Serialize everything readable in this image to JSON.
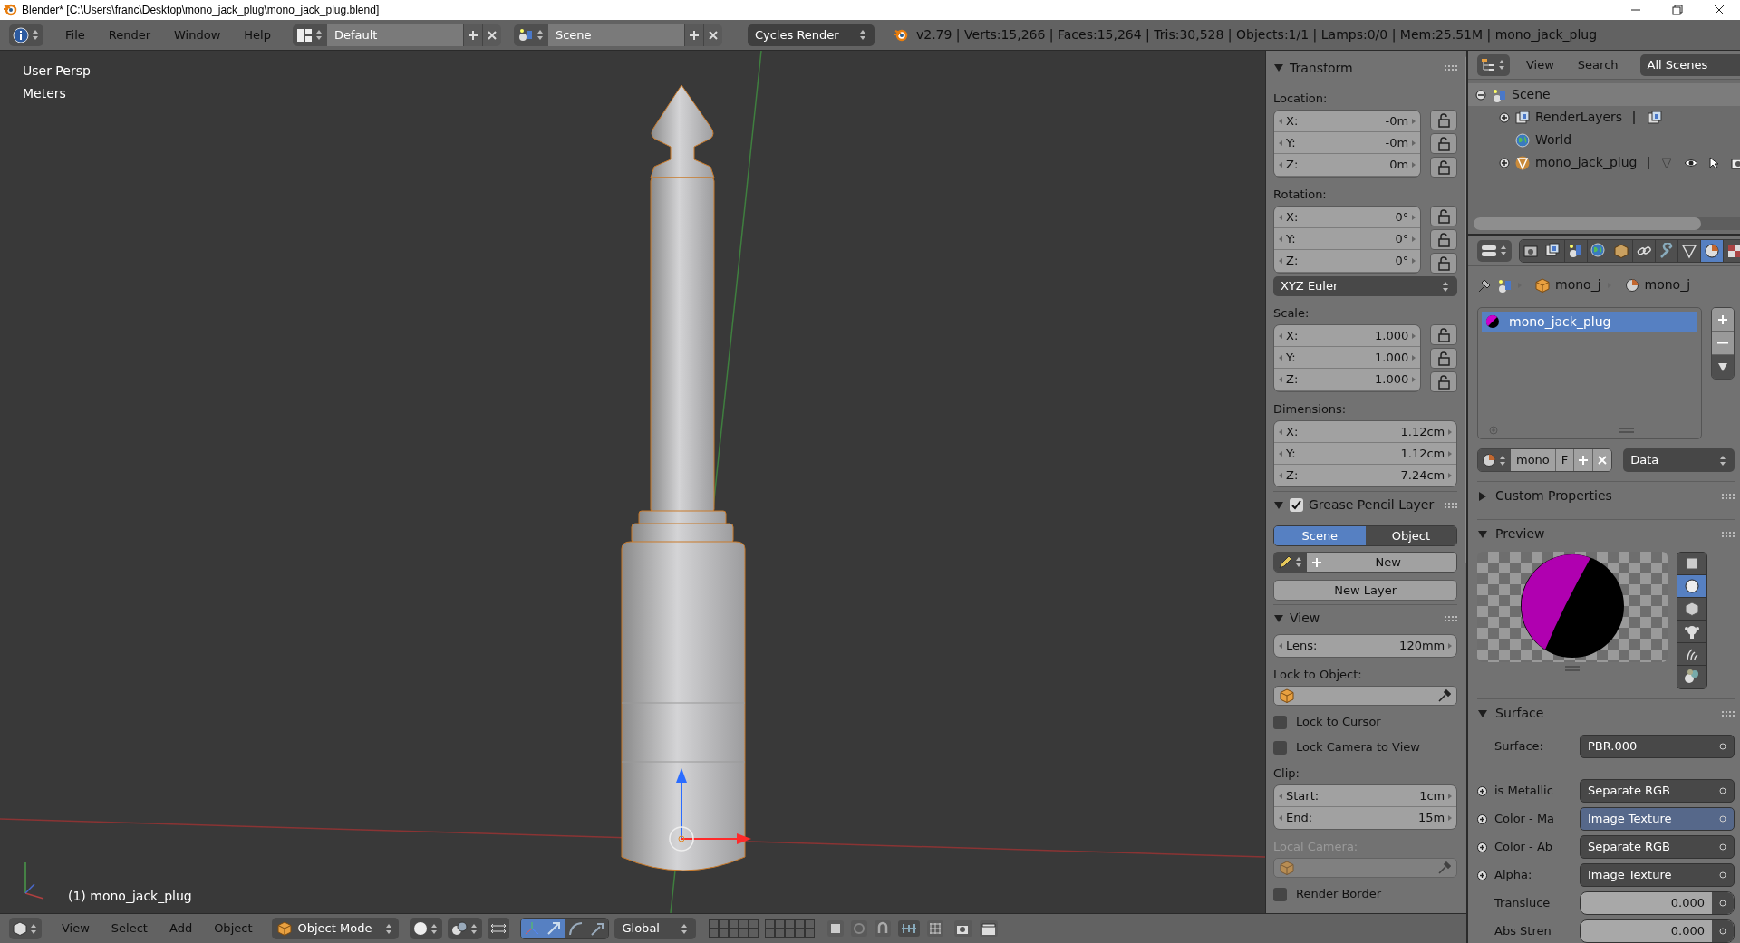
{
  "window": {
    "title": "Blender* [C:\\Users\\franc\\Desktop\\mono_jack_plug\\mono_jack_plug.blend]"
  },
  "info_header": {
    "menus": [
      "File",
      "Render",
      "Window",
      "Help"
    ],
    "screen_layout": "Default",
    "scene": "Scene",
    "render_engine": "Cycles Render",
    "stats": "v2.79 | Verts:15,266 | Faces:15,264 | Tris:30,528 | Objects:1/1 | Lamps:0/0 | Mem:25.51M | mono_jack_plug"
  },
  "viewport": {
    "view_name": "User Persp",
    "units": "Meters",
    "active_object": "(1) mono_jack_plug"
  },
  "n_panel": {
    "sections": [
      {
        "title": "Transform",
        "expanded": true,
        "rows": [
          {
            "kind": "label",
            "text": "Location:",
            "disabled": false
          },
          {
            "kind": "vector",
            "fields": [
              {
                "label": "X:",
                "value": "-0m",
                "locked": false
              },
              {
                "label": "Y:",
                "value": "-0m",
                "locked": false
              },
              {
                "label": "Z:",
                "value": "0m",
                "locked": false
              }
            ]
          },
          {
            "kind": "label",
            "text": "Rotation:",
            "disabled": false
          },
          {
            "kind": "vector",
            "fields": [
              {
                "label": "X:",
                "value": "0°",
                "locked": false
              },
              {
                "label": "Y:",
                "value": "0°",
                "locked": false
              },
              {
                "label": "Z:",
                "value": "0°",
                "locked": false
              }
            ]
          },
          {
            "kind": "dropdown",
            "value": "XYZ Euler"
          },
          {
            "kind": "label",
            "text": "Scale:",
            "disabled": false
          },
          {
            "kind": "vector",
            "fields": [
              {
                "label": "X:",
                "value": "1.000",
                "locked": false
              },
              {
                "label": "Y:",
                "value": "1.000",
                "locked": false
              },
              {
                "label": "Z:",
                "value": "1.000",
                "locked": false
              }
            ]
          },
          {
            "kind": "label",
            "text": "Dimensions:",
            "disabled": false
          },
          {
            "kind": "vector",
            "fields": [
              {
                "label": "X:",
                "value": "1.12cm"
              },
              {
                "label": "Y:",
                "value": "1.12cm"
              },
              {
                "label": "Z:",
                "value": "7.24cm"
              }
            ]
          }
        ]
      },
      {
        "title": "Grease Pencil Layer",
        "enabled": true,
        "expanded": true,
        "rows": [
          {
            "kind": "segmented",
            "options": [
              {
                "label": "Scene",
                "selected": true
              },
              {
                "label": "Object",
                "selected": false
              }
            ]
          },
          {
            "kind": "new_button",
            "label": "New"
          },
          {
            "kind": "button",
            "label": "New Layer"
          }
        ]
      },
      {
        "title": "View",
        "expanded": true,
        "rows": [
          {
            "kind": "vector",
            "fields": [
              {
                "label": "Lens:",
                "value": "120mm"
              }
            ]
          },
          {
            "kind": "label",
            "text": "Lock to Object:",
            "disabled": false
          },
          {
            "kind": "object_picker",
            "disabled": false
          },
          {
            "kind": "checkbox",
            "label": "Lock to Cursor",
            "checked": false
          },
          {
            "kind": "checkbox",
            "label": "Lock Camera to View",
            "checked": false
          },
          {
            "kind": "label",
            "text": "Clip:",
            "disabled": false
          },
          {
            "kind": "vector",
            "fields": [
              {
                "label": "Start:",
                "value": "1cm"
              },
              {
                "label": "End:",
                "value": "15m"
              }
            ]
          },
          {
            "kind": "label",
            "text": "Local Camera:",
            "disabled": true
          },
          {
            "kind": "object_picker",
            "disabled": true
          },
          {
            "kind": "checkbox",
            "label": "Render Border",
            "checked": false
          }
        ]
      }
    ]
  },
  "viewport_header": {
    "menus": [
      "View",
      "Select",
      "Add",
      "Object"
    ],
    "mode": "Object Mode",
    "orientation": "Global",
    "manipulators": [
      {
        "kind": "toggle",
        "selected": true
      },
      {
        "kind": "translate",
        "selected": true
      },
      {
        "kind": "rotate",
        "selected": false
      },
      {
        "kind": "scale",
        "selected": false
      }
    ]
  },
  "outliner": {
    "menus": [
      "View",
      "Search"
    ],
    "display_mode": "All Scenes",
    "tree": [
      {
        "label": "Scene",
        "kind": "scene",
        "expanded": true,
        "selected": true,
        "children": [
          {
            "label": "RenderLayers",
            "kind": "render_layers",
            "expanded": false,
            "selected": false
          },
          {
            "label": "World",
            "kind": "world",
            "selected": false
          },
          {
            "label": "mono_jack_plug",
            "kind": "mesh_object",
            "expanded": false,
            "selected": false
          }
        ]
      }
    ]
  },
  "properties": {
    "tabs": [
      {
        "kind": "render",
        "selected": false
      },
      {
        "kind": "render_layers",
        "selected": false
      },
      {
        "kind": "scene",
        "selected": false
      },
      {
        "kind": "world",
        "selected": false
      },
      {
        "kind": "object",
        "selected": false
      },
      {
        "kind": "constraints",
        "selected": false
      },
      {
        "kind": "modifiers",
        "selected": false
      },
      {
        "kind": "data",
        "selected": false
      },
      {
        "kind": "material",
        "selected": true
      },
      {
        "kind": "texture",
        "selected": false
      }
    ],
    "context_path": [
      "mono_j",
      "mono_j"
    ],
    "material_slots": [
      {
        "name": "mono_jack_plug",
        "selected": true
      }
    ],
    "material_name": "mono",
    "fake_user": "F",
    "link": "Data",
    "panels": [
      {
        "title": "Custom Properties",
        "expanded": false
      },
      {
        "kind": "preview",
        "title": "Preview",
        "expanded": true,
        "shapes": [
          {
            "kind": "plane",
            "selected": false
          },
          {
            "kind": "sphere",
            "selected": true
          },
          {
            "kind": "cube",
            "selected": false
          },
          {
            "kind": "monkey",
            "selected": false
          },
          {
            "kind": "hair",
            "selected": false
          },
          {
            "kind": "sky",
            "selected": false
          }
        ]
      },
      {
        "kind": "surface",
        "title": "Surface",
        "expanded": true,
        "rows": [
          {
            "kind": "node",
            "label": "Surface:",
            "value": "PBR.000",
            "expandable": false,
            "highlighted": false
          },
          {
            "kind": "node",
            "label": "is Metallic",
            "value": "Separate RGB",
            "expandable": true,
            "highlighted": false
          },
          {
            "kind": "node",
            "label": "Color - Ma",
            "value": "Image Texture",
            "expandable": true,
            "highlighted": true
          },
          {
            "kind": "node",
            "label": "Color - Ab",
            "value": "Separate RGB",
            "expandable": true,
            "highlighted": false
          },
          {
            "kind": "node",
            "label": "Alpha:",
            "value": "Image Texture",
            "expandable": true,
            "highlighted": false
          },
          {
            "kind": "number",
            "label": "Transluce",
            "value": "0.000",
            "expandable": false,
            "highlighted": false
          },
          {
            "kind": "number",
            "label": "Abs Stren",
            "value": "0.000",
            "expandable": false,
            "highlighted": false
          }
        ]
      }
    ]
  }
}
